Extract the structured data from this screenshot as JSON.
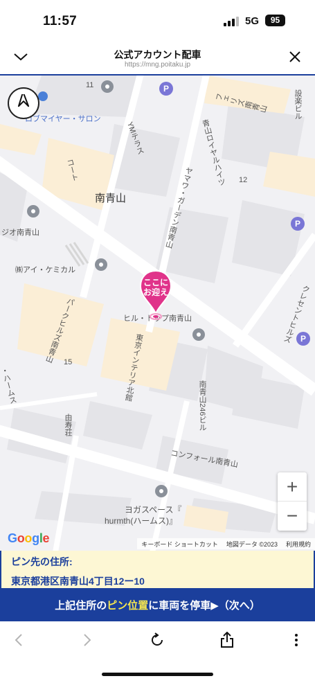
{
  "status_bar": {
    "time": "11:57",
    "network": "5G",
    "battery": "95",
    "signal_bars": 3
  },
  "header": {
    "collapse_icon": "chevron-down-icon",
    "title": "公式アカウント配車",
    "url": "https://mng.poitaku.jp",
    "close_icon": "close-icon"
  },
  "map": {
    "compass_icon": "navigation-arrow-icon",
    "labels": {
      "salon": "ロブマイヤー・サロン",
      "ym_terrace": "YMテラス",
      "futeris": "フェリズ南青山",
      "sekkei_bldg": "設楽ビル",
      "aoyama_royal": "青山ロイヤルハイツ",
      "koto": "コート",
      "minami_aoyama": "南青山",
      "yamawa_garden": "ヤマワ・ガーデン南青山",
      "jio": "ジオ南青山",
      "ai_chemical": "㈱アイ・ケミカル",
      "park_hills": "パークヒルズ南青山",
      "hill_top": "ヒル・トップ南青山",
      "tokyo_interior": "東京インテリア北館",
      "crescent": "クレセントヒルズ",
      "hurmth_left": "・ハームス",
      "yushuso": "由寿荘",
      "minami_aoyama_246": "南青山246ビル",
      "comfort": "コンフォール南青山",
      "yoga_space": "ヨガスペース『",
      "hurmth": "hurmth(ハームス)』",
      "block_11": "11",
      "block_12": "12",
      "block_15": "15"
    },
    "pin_text": "ここにお迎え",
    "pin_color": "#e0338a",
    "zoom_in": "+",
    "zoom_out": "−",
    "google": "Google",
    "attribution": {
      "shortcuts": "キーボード ショートカット",
      "map_data": "地図データ ©2023",
      "terms": "利用規約"
    }
  },
  "address": {
    "label": "ピン先の住所:",
    "value": "東京都港区南青山4丁目12ー10"
  },
  "cta": {
    "part1": "上記住所の",
    "highlight": "ピン位置",
    "part2": "に車両を停車▶（次へ）",
    "bg_color": "#1b3f9c",
    "highlight_color": "#f6e64f"
  },
  "toolbar": {
    "back_icon": "chevron-left-icon",
    "forward_icon": "chevron-right-icon",
    "reload_icon": "reload-icon",
    "share_icon": "share-icon",
    "more_icon": "more-vertical-icon"
  }
}
